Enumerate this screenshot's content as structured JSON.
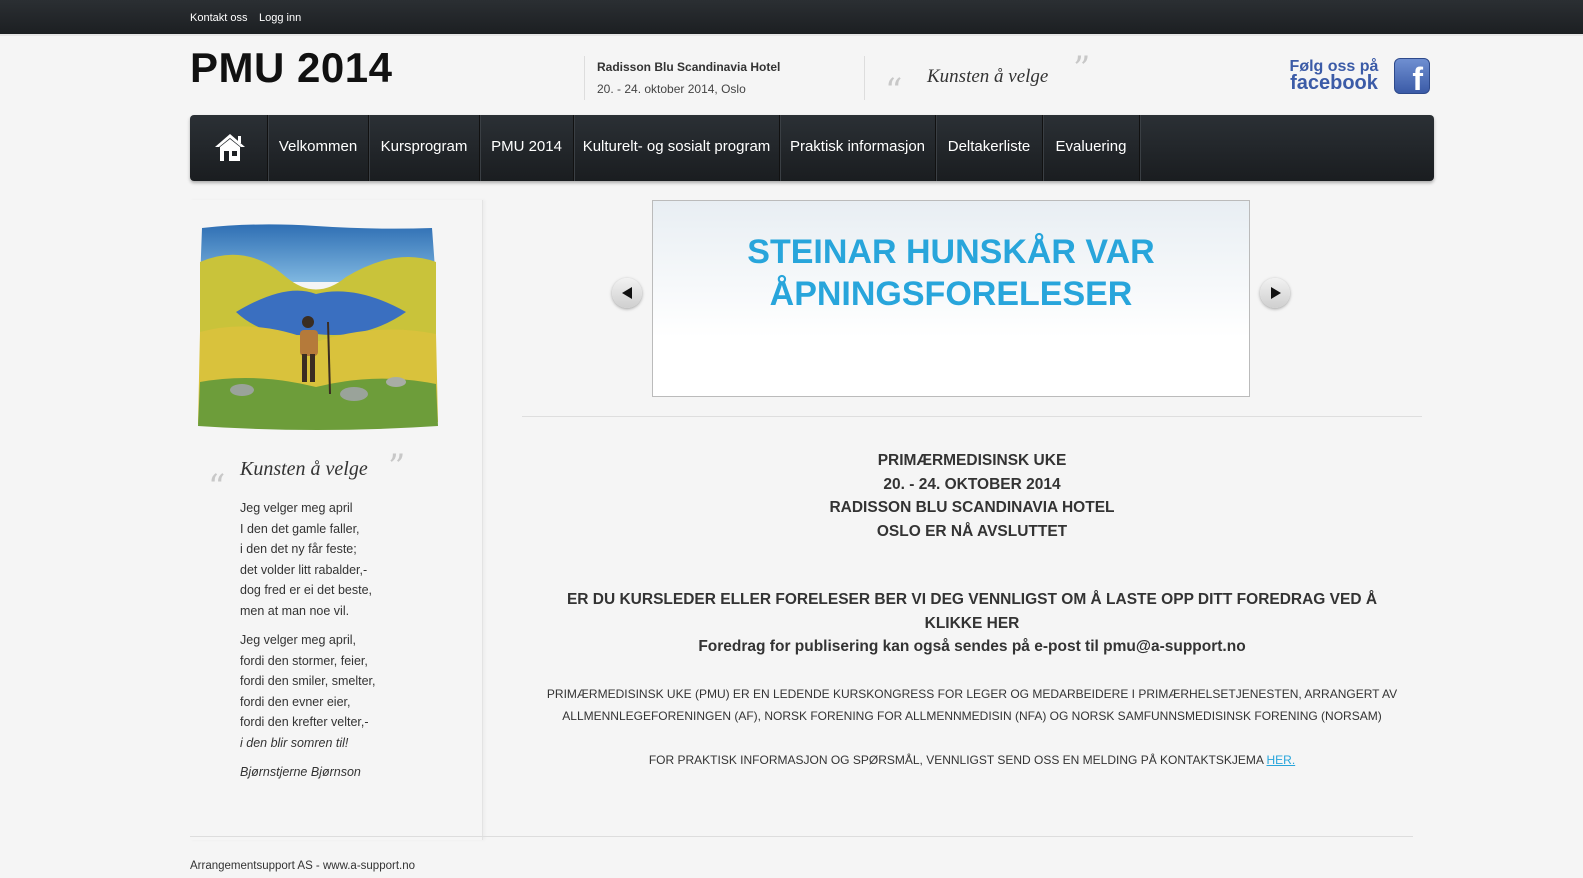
{
  "topbar": {
    "contact": "Kontakt oss",
    "login": "Logg inn"
  },
  "header": {
    "site_title": "PMU 2014",
    "venue_line1": "Radisson Blu Scandinavia Hotel",
    "venue_line2": "20. - 24. oktober 2014, Oslo",
    "quote_text": "Kunsten å velge",
    "facebook_line1": "Følg oss på",
    "facebook_line2": "facebook",
    "facebook_icon_letter": "f"
  },
  "nav": {
    "items": [
      "Velkommen",
      "Kursprogram",
      "PMU 2014",
      "Kulturelt- og sosialt program",
      "Praktisk informasjon",
      "Deltakerliste",
      "Evaluering"
    ]
  },
  "sidebar": {
    "quote_title": "Kunsten å velge",
    "stanza1": [
      "Jeg velger meg april",
      "I den det gamle faller,",
      "i den det ny får feste;",
      "det volder litt rabalder,-",
      "dog fred er ei det beste,",
      "men at man noe vil."
    ],
    "stanza2": [
      "Jeg velger meg april,",
      "fordi den stormer, feier,",
      "fordi den smiler, smelter,",
      "fordi den evner eier,",
      "fordi den krefter velter,-"
    ],
    "stanza2_last": "i den blir somren til!",
    "author": "Bjørnstjerne Bjørnson"
  },
  "slider": {
    "title_line1": "STEINAR HUNSKÅR VAR",
    "title_line2": "ÅPNINGSFORELESER"
  },
  "main": {
    "event_lines": [
      "PRIMÆRMEDISINSK UKE",
      "20. - 24. OKTOBER 2014",
      "RADISSON BLU SCANDINAVIA HOTEL",
      "OSLO ER NÅ AVSLUTTET"
    ],
    "upload_line1": "ER DU KURSLEDER ELLER FORELESER BER VI DEG VENNLIGST OM Å LASTE OPP DITT FOREDRAG VED Å",
    "upload_line2": "KLIKKE HER",
    "upload_email": "Foredrag for publisering kan også sendes på e-post til pmu@a-support.no",
    "about_line1": "PRIMÆRMEDISINSK UKE (PMU) ER EN LEDENDE KURSKONGRESS FOR LEGER OG MEDARBEIDERE I PRIMÆRHELSETJENESTEN, ARRANGERT AV",
    "about_line2": "ALLMENNLEGEFORENINGEN (AF), NORSK FORENING FOR ALLMENNMEDISIN (NFA) OG NORSK SAMFUNNSMEDISINSK FORENING (NORSAM)",
    "contact_text": "FOR PRAKTISK INFORMASJON OG SPØRSMÅL, VENNLIGST SEND OSS EN MELDING PÅ KONTAKTSKJEMA ",
    "contact_link": "HER."
  },
  "footer": {
    "text": "Arrangementsupport AS - www.a-support.no"
  }
}
